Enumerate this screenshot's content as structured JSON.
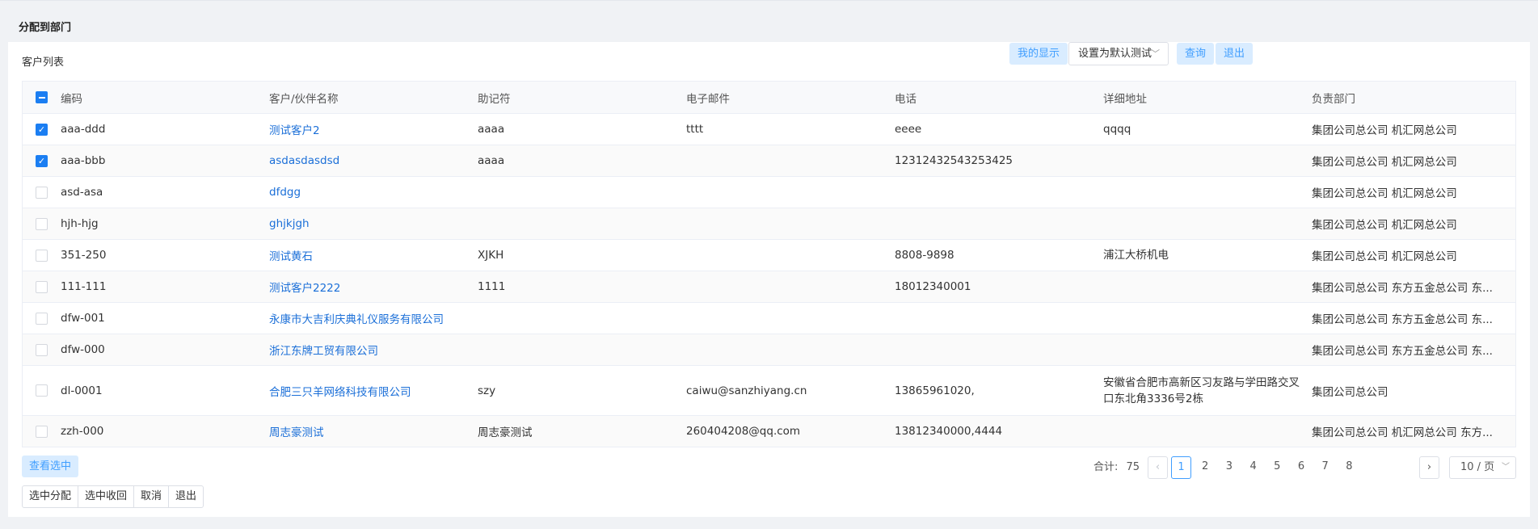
{
  "page": {
    "title": "分配到部门"
  },
  "list": {
    "title": "客户列表",
    "my_display_label": "我的显示",
    "default_select_value": "设置为默认测试",
    "query_label": "查询",
    "exit_label": "退出"
  },
  "table": {
    "columns": [
      "编码",
      "客户/伙伴名称",
      "助记符",
      "电子邮件",
      "电话",
      "详细地址",
      "负责部门"
    ],
    "header_checkbox": "indeterminate",
    "rows": [
      {
        "checked": true,
        "code": "aaa-ddd",
        "name": "测试客户2",
        "mnemonic": "aaaa",
        "email": "tttt",
        "phone": "eeee",
        "address": "qqqq",
        "dept": "集团公司总公司 机汇网总公司"
      },
      {
        "checked": true,
        "code": "aaa-bbb",
        "name": "asdasdasdsd",
        "mnemonic": "aaaa",
        "email": "",
        "phone": "12312432543253425",
        "address": "",
        "dept": "集团公司总公司 机汇网总公司"
      },
      {
        "checked": false,
        "code": "asd-asa",
        "name": "dfdgg",
        "mnemonic": "",
        "email": "",
        "phone": "",
        "address": "",
        "dept": "集团公司总公司 机汇网总公司"
      },
      {
        "checked": false,
        "code": "hjh-hjg",
        "name": "ghjkjgh",
        "mnemonic": "",
        "email": "",
        "phone": "",
        "address": "",
        "dept": "集团公司总公司 机汇网总公司"
      },
      {
        "checked": false,
        "code": "351-250",
        "name": "测试黄石",
        "mnemonic": "XJKH",
        "email": "",
        "phone": "8808-9898",
        "address": "浦江大桥机电",
        "dept": "集团公司总公司 机汇网总公司"
      },
      {
        "checked": false,
        "code": "111-111",
        "name": "测试客户2222",
        "mnemonic": "1111",
        "email": "",
        "phone": "18012340001",
        "address": "",
        "dept": "集团公司总公司 东方五金总公司 东..."
      },
      {
        "checked": false,
        "code": "dfw-001",
        "name": "永康市大吉利庆典礼仪服务有限公司",
        "mnemonic": "",
        "email": "",
        "phone": "",
        "address": "",
        "dept": "集团公司总公司 东方五金总公司 东..."
      },
      {
        "checked": false,
        "code": "dfw-000",
        "name": "浙江东牌工贸有限公司",
        "mnemonic": "",
        "email": "",
        "phone": "",
        "address": "",
        "dept": "集团公司总公司 东方五金总公司 东..."
      },
      {
        "checked": false,
        "code": "dl-0001",
        "name": "合肥三只羊网络科技有限公司",
        "mnemonic": "szy",
        "email": "caiwu@sanzhiyang.cn",
        "phone": "13865961020,",
        "address": "安徽省合肥市高新区习友路与学田路交叉口东北角3336号2栋",
        "dept": "集团公司总公司"
      },
      {
        "checked": false,
        "code": "zzh-000",
        "name": "周志豪测试",
        "mnemonic": "周志豪测试",
        "email": "260404208@qq.com",
        "phone": "13812340000,4444",
        "address": "",
        "dept": "集团公司总公司 机汇网总公司 东方..."
      }
    ]
  },
  "footer": {
    "view_selected_label": "查看选中",
    "actions": [
      "选中分配",
      "选中收回",
      "取消",
      "退出"
    ]
  },
  "pagination": {
    "total_label": "合计:",
    "total": "75",
    "prev_icon": "‹",
    "next_icon": "›",
    "pages": [
      "1",
      "2",
      "3",
      "4",
      "5",
      "6",
      "7",
      "8"
    ],
    "current_page": "1",
    "page_size": "10 / 页"
  }
}
